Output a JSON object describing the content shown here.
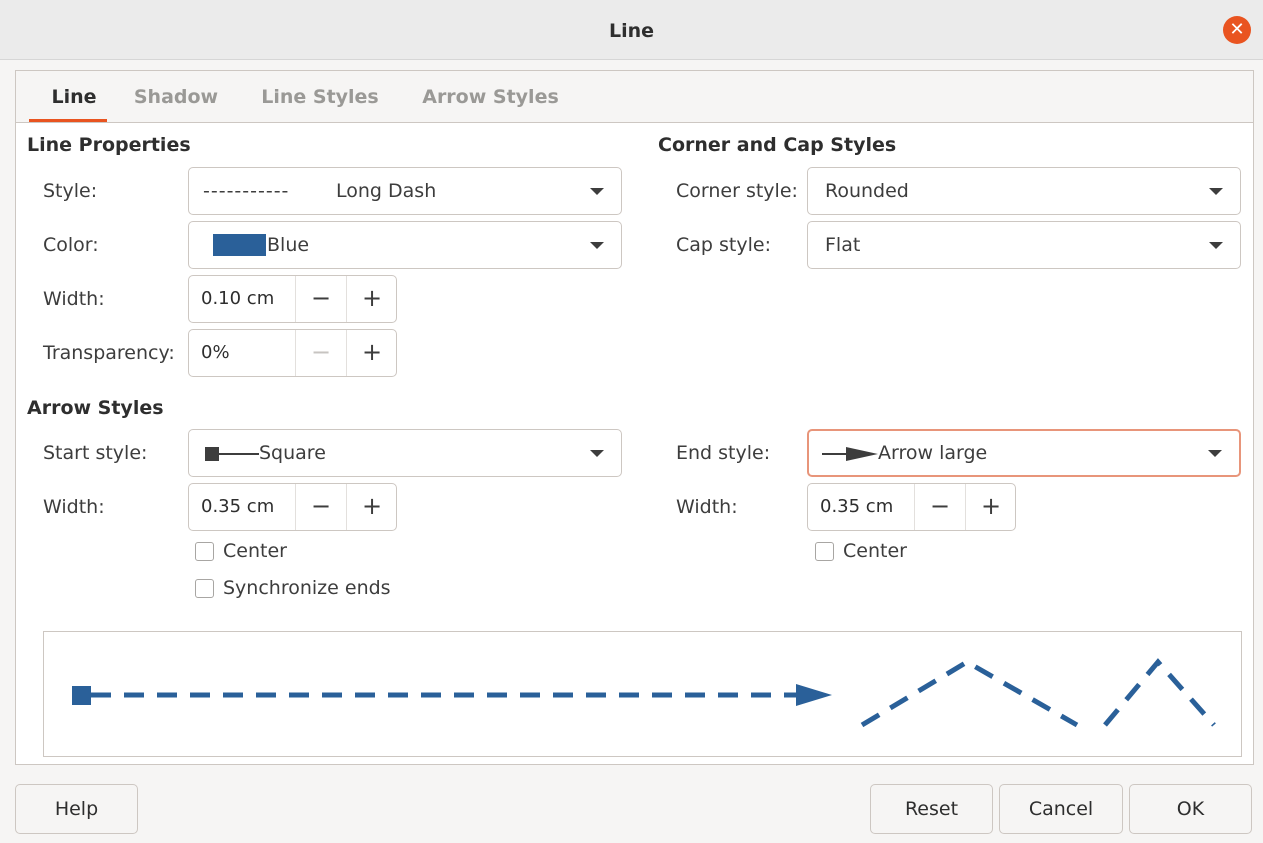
{
  "window": {
    "title": "Line",
    "close_glyph": "✕"
  },
  "tabs": [
    {
      "label": "Line",
      "active": true
    },
    {
      "label": "Shadow",
      "active": false
    },
    {
      "label": "Line Styles",
      "active": false
    },
    {
      "label": "Arrow Styles",
      "active": false
    }
  ],
  "line_properties": {
    "title": "Line Properties",
    "style_label": "Style:",
    "style_dash_glyph": "-----------",
    "style_value": "Long Dash",
    "color_label": "Color:",
    "color_value": "Blue",
    "color_hex": "#2a6099",
    "width_label": "Width:",
    "width_value": "0.10 cm",
    "transparency_label": "Transparency:",
    "transparency_value": "0%"
  },
  "corner_cap": {
    "title": "Corner and Cap Styles",
    "corner_label": "Corner style:",
    "corner_value": "Rounded",
    "cap_label": "Cap style:",
    "cap_value": "Flat"
  },
  "arrow_styles": {
    "title": "Arrow Styles",
    "start_label": "Start style:",
    "start_value": "Square",
    "start_width_label": "Width:",
    "start_width_value": "0.35 cm",
    "start_center_label": "Center",
    "sync_label": "Synchronize ends",
    "end_label": "End style:",
    "end_value": "Arrow large",
    "end_width_label": "Width:",
    "end_width_value": "0.35 cm",
    "end_center_label": "Center"
  },
  "spin_glyphs": {
    "minus": "−",
    "plus": "+"
  },
  "buttons": {
    "help": "Help",
    "reset": "Reset",
    "cancel": "Cancel",
    "ok": "OK"
  },
  "colors": {
    "accent": "#e95420",
    "line": "#2a6099"
  }
}
